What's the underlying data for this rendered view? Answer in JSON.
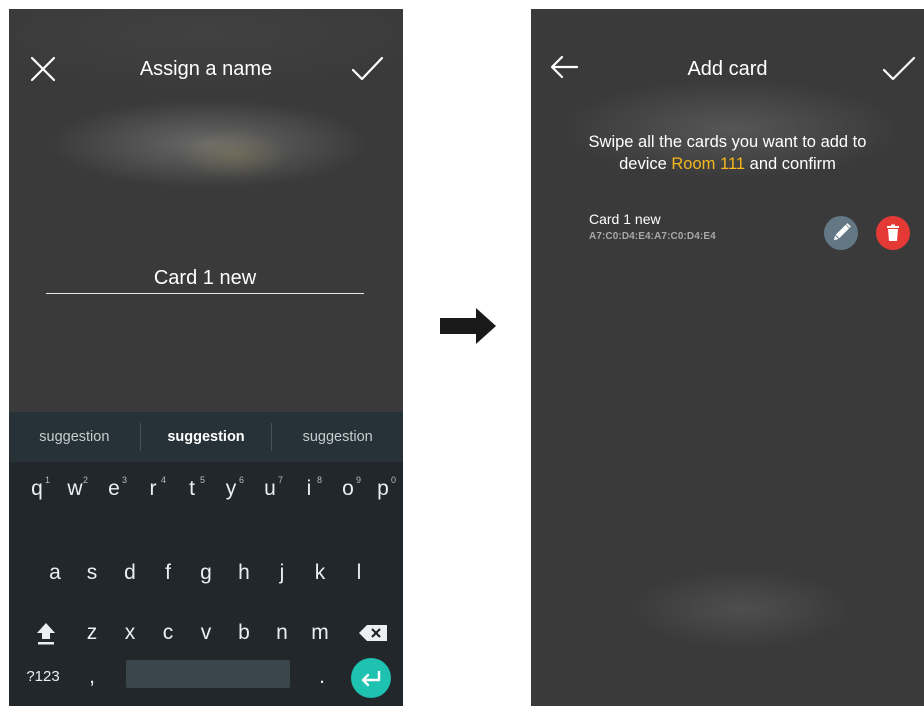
{
  "left_screen": {
    "title": "Assign a name",
    "close_icon": "close-icon",
    "confirm_icon": "check-icon",
    "name_value": "Card 1 new",
    "suggestions": [
      "suggestion",
      "suggestion",
      "suggestion"
    ],
    "keyboard": {
      "row1": [
        {
          "key": "q",
          "hint": "1"
        },
        {
          "key": "w",
          "hint": "2"
        },
        {
          "key": "e",
          "hint": "3"
        },
        {
          "key": "r",
          "hint": "4"
        },
        {
          "key": "t",
          "hint": "5"
        },
        {
          "key": "y",
          "hint": "6"
        },
        {
          "key": "u",
          "hint": "7"
        },
        {
          "key": "i",
          "hint": "8"
        },
        {
          "key": "o",
          "hint": "9"
        },
        {
          "key": "p",
          "hint": "0"
        }
      ],
      "row2": [
        "a",
        "s",
        "d",
        "f",
        "g",
        "h",
        "j",
        "k",
        "l"
      ],
      "row3": [
        "z",
        "x",
        "c",
        "v",
        "b",
        "n",
        "m"
      ],
      "symbols_label": "?123",
      "comma_label": ",",
      "period_label": ".",
      "shift_icon": "shift-icon",
      "backspace_icon": "backspace-icon",
      "enter_icon": "enter-icon"
    }
  },
  "flow_arrow_icon": "arrow-right-icon",
  "right_screen": {
    "title": "Add card",
    "back_icon": "arrow-left-icon",
    "confirm_icon": "check-icon",
    "instructions": {
      "line1": "Swipe all the cards you want to add to",
      "line2_prefix": "device ",
      "device_name": "Room 111",
      "line2_suffix": " and confirm"
    },
    "cards": [
      {
        "name": "Card 1 new",
        "id": "A7:C0:D4:E4:A7:C0:D4:E4",
        "edit_icon": "pencil-icon",
        "delete_icon": "trash-icon"
      }
    ]
  },
  "colors": {
    "screen_background": "#3a3a3a",
    "highlight": "#f5b81c",
    "keyboard_background": "#21272b",
    "suggestion_bar": "#263238",
    "enter_key": "#1fc1b0",
    "edit_button": "#637884",
    "delete_button": "#e53935"
  }
}
